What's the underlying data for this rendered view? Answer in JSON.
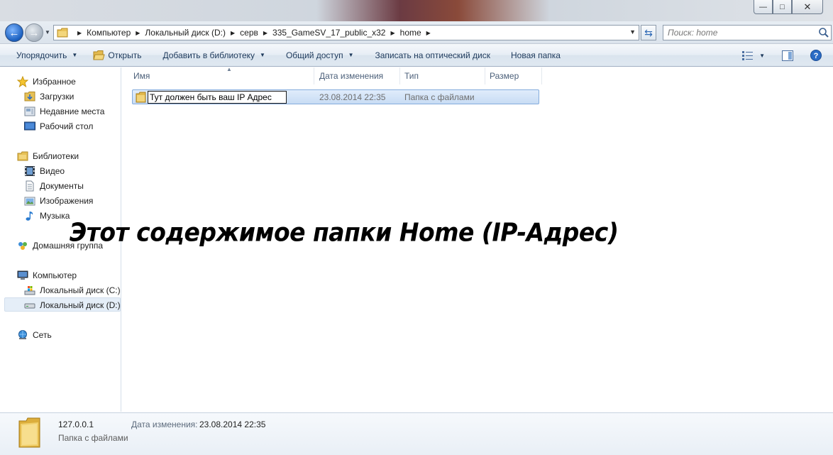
{
  "window": {
    "minimize": "—",
    "maximize": "□",
    "close": "✕"
  },
  "address": {
    "breadcrumbs": [
      "Компьютер",
      "Локальный диск  (D:)",
      "серв",
      "335_GameSV_17_public_x32",
      "home"
    ],
    "search_placeholder": "Поиск: home"
  },
  "toolbar": {
    "organize": "Упорядочить",
    "open": "Открыть",
    "add_to_library": "Добавить в библиотеку",
    "share": "Общий доступ",
    "burn": "Записать на оптический диск",
    "new_folder": "Новая папка"
  },
  "nav": {
    "favorites": "Избранное",
    "downloads": "Загрузки",
    "recent": "Недавние места",
    "desktop": "Рабочий стол",
    "libraries": "Библиотеки",
    "video": "Видео",
    "documents": "Документы",
    "pictures": "Изображения",
    "music": "Музыка",
    "homegroup": "Домашняя группа",
    "computer": "Компьютер",
    "drive_c": "Локальный диск (C:)",
    "drive_d": "Локальный диск  (D:)",
    "network": "Сеть"
  },
  "columns": {
    "name": "Имя",
    "date": "Дата изменения",
    "type": "Тип",
    "size": "Размер"
  },
  "files": [
    {
      "rename_value": "Тут должен быть ваш IP Адрес",
      "date": "23.08.2014 22:35",
      "type": "Папка с файлами"
    }
  ],
  "overlay_caption": "Этот содержимое папки Home (IP-Адрес)",
  "details": {
    "name": "127.0.0.1",
    "type": "Папка с файлами",
    "modified_label": "Дата изменения:",
    "modified_value": "23.08.2014 22:35"
  }
}
